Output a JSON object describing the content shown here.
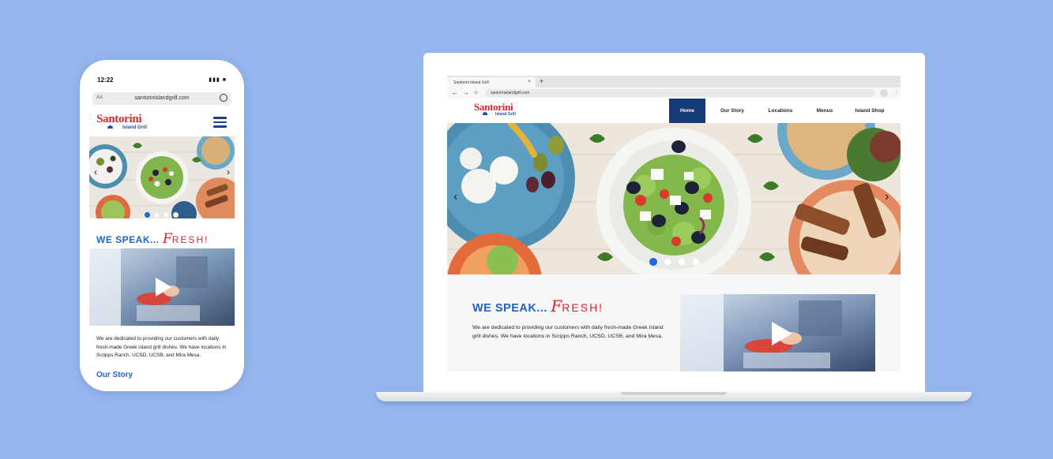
{
  "phone": {
    "status_time": "12:22",
    "status_icons": "▮▮▮ ■",
    "url_aa": "AA",
    "url": "santorinislandgrill.com",
    "logo_main": "Santorini",
    "logo_sub": "Island Grill",
    "speak_a": "WE SPEAK...",
    "speak_f": "F",
    "speak_b": "RESH!",
    "description": "We are dedicated to providing our customers with daily fresh-made Greek island grill dishes. We have locations in Scripps Ranch, UCSD, UCSB, and Mira Mesa.",
    "our_story": "Our Story"
  },
  "browser": {
    "tab_title": "Santorini Island Grill",
    "tab_close": "×",
    "new_tab": "+",
    "back": "←",
    "forward": "→",
    "reload": "○",
    "url": "santorinislandgrill.com"
  },
  "site": {
    "logo_main": "Santorini",
    "logo_sub": "Island Grill",
    "nav": [
      "Home",
      "Our Story",
      "Locations",
      "Menus",
      "Island Shop"
    ],
    "active_nav": "Home",
    "arrow_left": "‹",
    "arrow_right": "›",
    "slides": 4,
    "active_slide": 1,
    "speak_a": "WE SPEAK...",
    "speak_f": "F",
    "speak_b": "RESH!",
    "description": "We are dedicated to providing our customers with daily fresh-made Greek Island grill dishes. We have locations in Scripps Ranch, UCSD, UCSB, and Mira Mesa."
  },
  "colors": {
    "background": "#94b6ec",
    "brand_red": "#d9232e",
    "brand_blue": "#1f63c9",
    "nav_active": "#143a78"
  },
  "icons": [
    "hamburger-menu-icon",
    "reload-icon",
    "play-icon",
    "chevron-left-icon",
    "chevron-right-icon"
  ]
}
